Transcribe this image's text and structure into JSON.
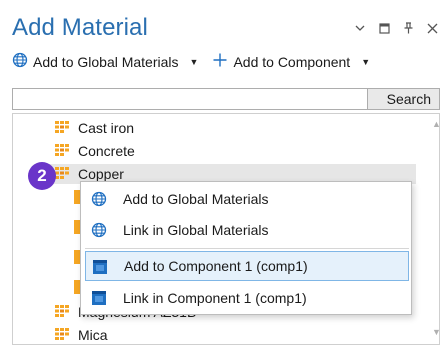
{
  "panel": {
    "title": "Add Material"
  },
  "toolbar": {
    "global_label": "Add to Global Materials",
    "component_label": "Add to Component"
  },
  "search": {
    "button_label": "Search",
    "value": ""
  },
  "tree": {
    "items": [
      {
        "label": "Cast iron"
      },
      {
        "label": "Concrete"
      },
      {
        "label": "Copper"
      }
    ],
    "partial_item": {
      "label": "Magnesium AZ31B"
    },
    "last_item": {
      "label": "Mica"
    }
  },
  "badge": {
    "number": "2",
    "color": "#6a35c9"
  },
  "context_menu": {
    "items": [
      {
        "label": "Add to Global Materials",
        "icon": "globe-icon"
      },
      {
        "label": "Link in Global Materials",
        "icon": "globe-icon"
      },
      {
        "label": "Add to Component 1 (comp1)",
        "icon": "component-icon",
        "highlighted": true
      },
      {
        "label": "Link in Component 1 (comp1)",
        "icon": "component-icon"
      }
    ]
  },
  "colors": {
    "title": "#2a6fb0",
    "globe": "#1f6fc1",
    "component": "#1f6fc1",
    "material_orange": "#f5a623",
    "highlight": "#e5f1fb"
  }
}
